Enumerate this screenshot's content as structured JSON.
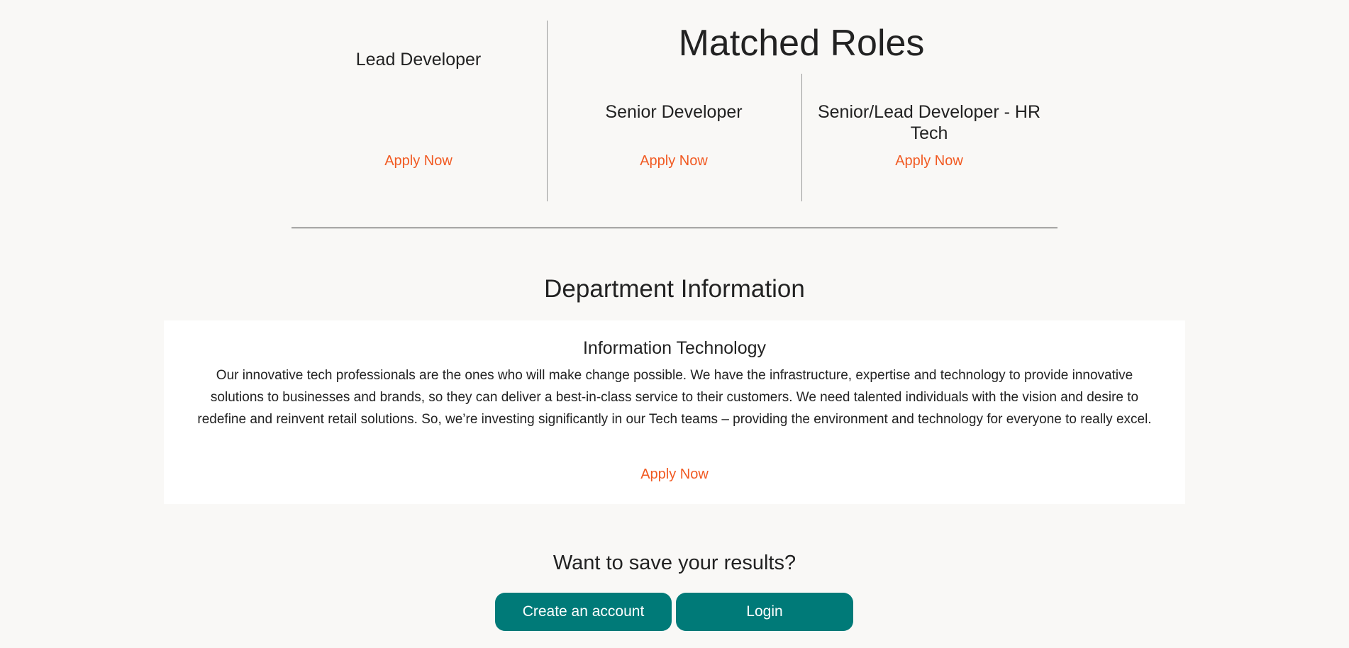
{
  "matched_roles": {
    "title": "Matched Roles",
    "roles": [
      {
        "title": "Lead Developer",
        "apply": "Apply Now"
      },
      {
        "title": "Senior Developer",
        "apply": "Apply Now"
      },
      {
        "title": "Senior/Lead Developer - HR Tech",
        "apply": "Apply Now"
      }
    ]
  },
  "department": {
    "heading": "Department Information",
    "name": "Information Technology",
    "description": "Our innovative tech professionals are the ones who will make change possible. We have the infrastructure, expertise and technology to provide innovative solutions to businesses and brands, so they can deliver a best-in-class service to their customers. We need talented individuals with the vision and desire to redefine and reinvent retail solutions. So, we’re investing significantly in our Tech teams – providing the environment and technology for everyone to really excel.",
    "apply": "Apply Now"
  },
  "save": {
    "heading": "Want to save your results?",
    "create_account": "Create an account",
    "login": "Login"
  },
  "colors": {
    "accent": "#f15a22",
    "button": "#007a78"
  }
}
